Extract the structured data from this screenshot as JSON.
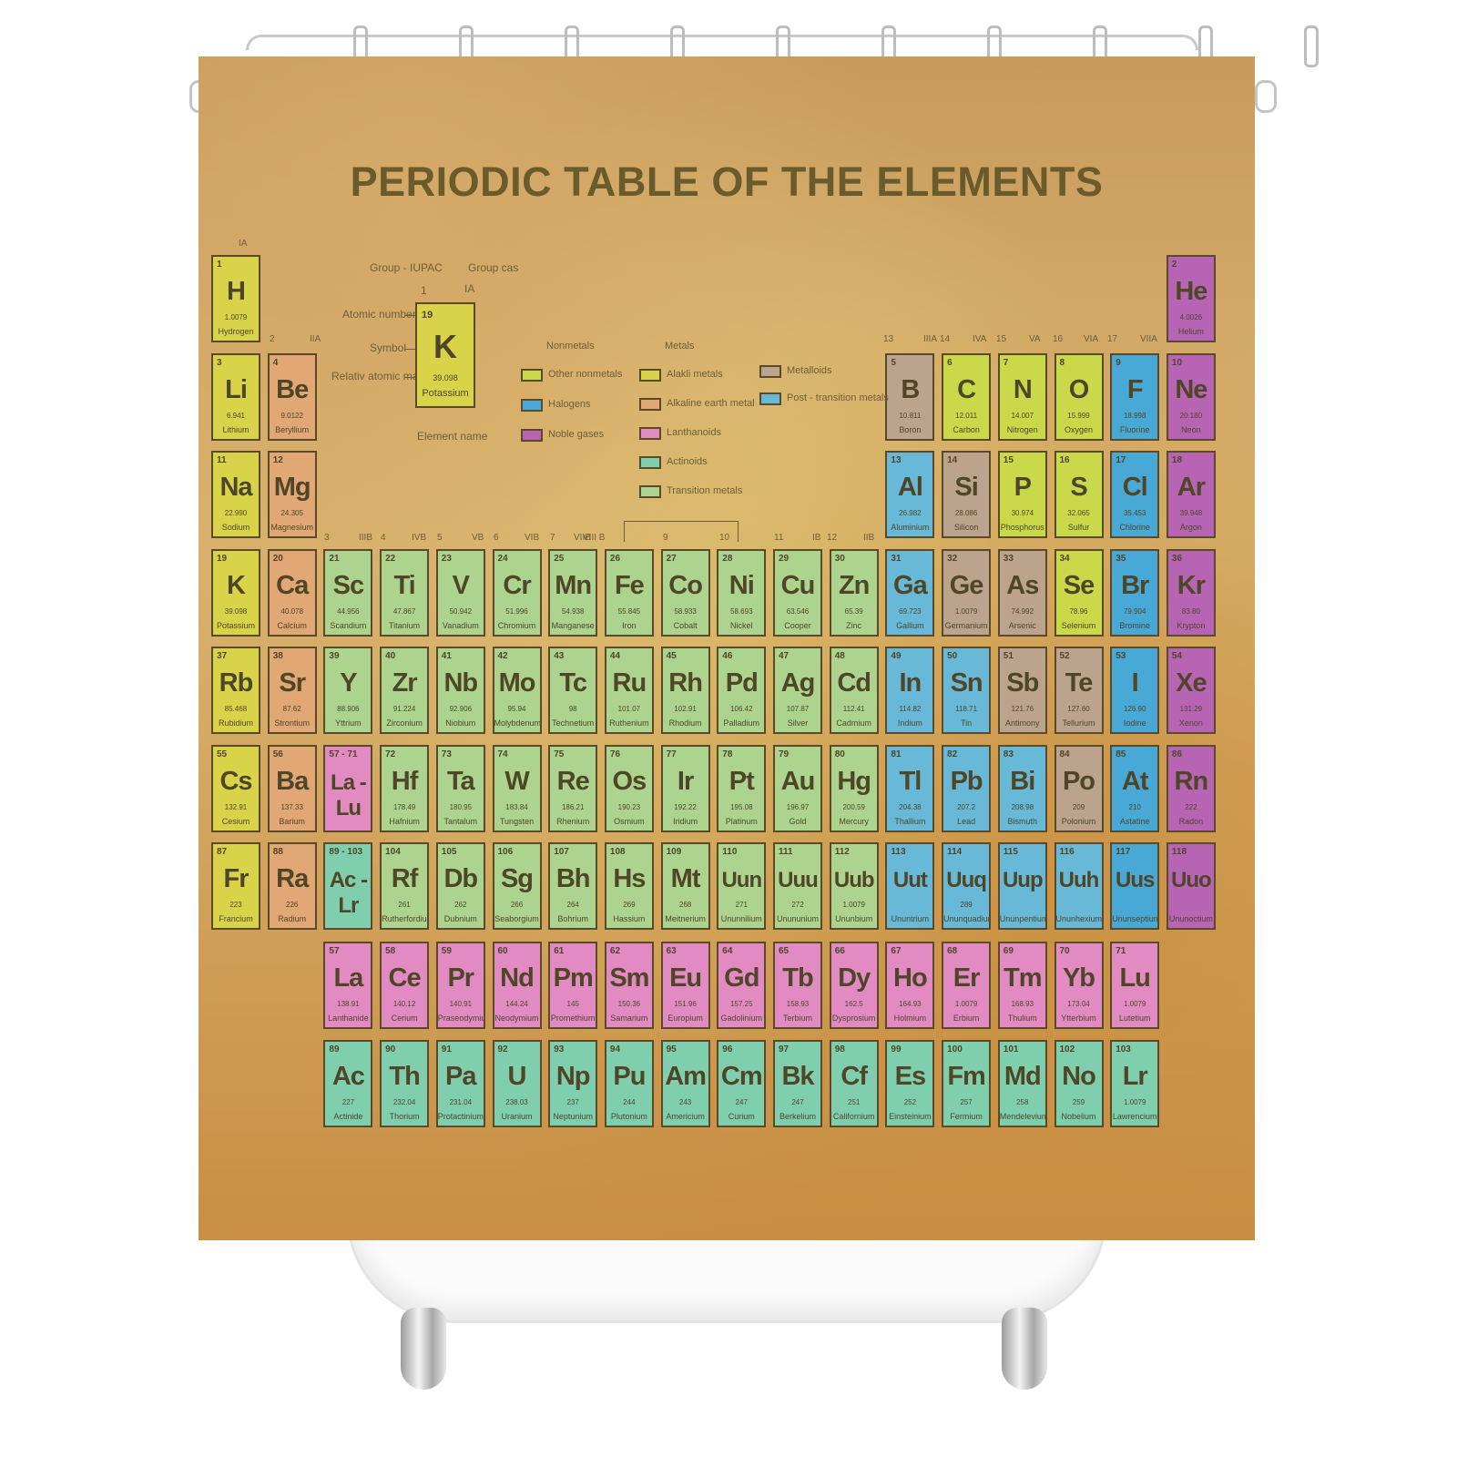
{
  "title": "PERIODIC  TABLE OF THE ELEMENTS",
  "key": {
    "group_iupac": "Group - IUPAC",
    "group_cas": "Group cas",
    "group_iupac_value": "1",
    "group_cas_value": "IA",
    "atomic_number": "Atomic number",
    "symbol": "Symbol",
    "relative_atomic_mass": "Relativ atomic mass",
    "element_name": "Element name",
    "cell": {
      "num": "19",
      "sym": "K",
      "mass": "39.098",
      "name": "Potassium"
    }
  },
  "legend": {
    "nonmetals_heading": "Nonmetals",
    "metals_heading": "Metals",
    "nonmetals": [
      {
        "label": "Other nonmetals",
        "color": "#c9d94a"
      },
      {
        "label": "Halogens",
        "color": "#48a8d6"
      },
      {
        "label": "Noble gases",
        "color": "#b764b4"
      }
    ],
    "metals": [
      {
        "label": "Alakli metals",
        "color": "#d9d34a"
      },
      {
        "label": "Alkaline earth metal",
        "color": "#e1a774"
      },
      {
        "label": "Lanthanoids",
        "color": "#e18bc2"
      },
      {
        "label": "Actinoids",
        "color": "#7fcfae"
      },
      {
        "label": "Transition metals",
        "color": "#acd48e"
      }
    ],
    "others": [
      {
        "label": "Metalloids",
        "color": "#bba38e"
      },
      {
        "label": "Post - transition metals",
        "color": "#68b8d8"
      }
    ]
  },
  "group_labels": [
    {
      "text": "IA"
    },
    {
      "text": "2"
    },
    {
      "text": "IIA"
    },
    {
      "text": "3"
    },
    {
      "text": "IIIB"
    },
    {
      "text": "4"
    },
    {
      "text": "IVB"
    },
    {
      "text": "5"
    },
    {
      "text": "VB"
    },
    {
      "text": "6"
    },
    {
      "text": "VIB"
    },
    {
      "text": "7"
    },
    {
      "text": "VIIB"
    },
    {
      "text": "VIII B"
    },
    {
      "text": "9"
    },
    {
      "text": "10"
    },
    {
      "text": "11"
    },
    {
      "text": "IB"
    },
    {
      "text": "12"
    },
    {
      "text": "IIB"
    },
    {
      "text": "13"
    },
    {
      "text": "IIIA"
    },
    {
      "text": "14"
    },
    {
      "text": "IVA"
    },
    {
      "text": "15"
    },
    {
      "text": "VA"
    },
    {
      "text": "16"
    },
    {
      "text": "VIA"
    },
    {
      "text": "17"
    },
    {
      "text": "VIIA"
    }
  ],
  "elements": [
    {
      "num": "1",
      "sym": "H",
      "mass": "1.0079",
      "name": "Hydrogen",
      "cls": "alkali"
    },
    {
      "num": "2",
      "sym": "He",
      "mass": "4.0026",
      "name": "Helium",
      "cls": "noble"
    },
    {
      "num": "3",
      "sym": "Li",
      "mass": "6.941",
      "name": "Lithium",
      "cls": "alkali"
    },
    {
      "num": "4",
      "sym": "Be",
      "mass": "9.0122",
      "name": "Beryllium",
      "cls": "alkaline"
    },
    {
      "num": "5",
      "sym": "B",
      "mass": "10.811",
      "name": "Boron",
      "cls": "metalloid"
    },
    {
      "num": "6",
      "sym": "C",
      "mass": "12.011",
      "name": "Carbon",
      "cls": "other"
    },
    {
      "num": "7",
      "sym": "N",
      "mass": "14.007",
      "name": "Nitrogen",
      "cls": "other"
    },
    {
      "num": "8",
      "sym": "O",
      "mass": "15.999",
      "name": "Oxygen",
      "cls": "other"
    },
    {
      "num": "9",
      "sym": "F",
      "mass": "18.998",
      "name": "Fluorine",
      "cls": "halogen"
    },
    {
      "num": "10",
      "sym": "Ne",
      "mass": "20.180",
      "name": "Neon",
      "cls": "noble"
    },
    {
      "num": "11",
      "sym": "Na",
      "mass": "22.990",
      "name": "Sodium",
      "cls": "alkali"
    },
    {
      "num": "12",
      "sym": "Mg",
      "mass": "24.305",
      "name": "Magnesium",
      "cls": "alkaline"
    },
    {
      "num": "13",
      "sym": "Al",
      "mass": "26.982",
      "name": "Aluminium",
      "cls": "post"
    },
    {
      "num": "14",
      "sym": "Si",
      "mass": "28.086",
      "name": "Silicon",
      "cls": "metalloid"
    },
    {
      "num": "15",
      "sym": "P",
      "mass": "30.974",
      "name": "Phosphorus",
      "cls": "other"
    },
    {
      "num": "16",
      "sym": "S",
      "mass": "32.065",
      "name": "Sulfur",
      "cls": "other"
    },
    {
      "num": "17",
      "sym": "Cl",
      "mass": "35.453",
      "name": "Chlorine",
      "cls": "halogen"
    },
    {
      "num": "18",
      "sym": "Ar",
      "mass": "39.948",
      "name": "Argon",
      "cls": "noble"
    },
    {
      "num": "19",
      "sym": "K",
      "mass": "39.098",
      "name": "Potassium",
      "cls": "alkali"
    },
    {
      "num": "20",
      "sym": "Ca",
      "mass": "40.078",
      "name": "Calcium",
      "cls": "alkaline"
    },
    {
      "num": "21",
      "sym": "Sc",
      "mass": "44.956",
      "name": "Scandium",
      "cls": "transition"
    },
    {
      "num": "22",
      "sym": "Ti",
      "mass": "47.867",
      "name": "Titanium",
      "cls": "transition"
    },
    {
      "num": "23",
      "sym": "V",
      "mass": "50.942",
      "name": "Vanadium",
      "cls": "transition"
    },
    {
      "num": "24",
      "sym": "Cr",
      "mass": "51.996",
      "name": "Chromium",
      "cls": "transition"
    },
    {
      "num": "25",
      "sym": "Mn",
      "mass": "54.938",
      "name": "Manganese",
      "cls": "transition"
    },
    {
      "num": "26",
      "sym": "Fe",
      "mass": "55.845",
      "name": "Iron",
      "cls": "transition"
    },
    {
      "num": "27",
      "sym": "Co",
      "mass": "58.933",
      "name": "Cobalt",
      "cls": "transition"
    },
    {
      "num": "28",
      "sym": "Ni",
      "mass": "58.693",
      "name": "Nickel",
      "cls": "transition"
    },
    {
      "num": "29",
      "sym": "Cu",
      "mass": "63.546",
      "name": "Cooper",
      "cls": "transition"
    },
    {
      "num": "30",
      "sym": "Zn",
      "mass": "65.39",
      "name": "Zinc",
      "cls": "transition"
    },
    {
      "num": "31",
      "sym": "Ga",
      "mass": "69.723",
      "name": "Gallium",
      "cls": "post"
    },
    {
      "num": "32",
      "sym": "Ge",
      "mass": "1.0079",
      "name": "Germanium",
      "cls": "metalloid"
    },
    {
      "num": "33",
      "sym": "As",
      "mass": "74.992",
      "name": "Arsenic",
      "cls": "metalloid"
    },
    {
      "num": "34",
      "sym": "Se",
      "mass": "78.96",
      "name": "Selenium",
      "cls": "other"
    },
    {
      "num": "35",
      "sym": "Br",
      "mass": "79.904",
      "name": "Bromine",
      "cls": "halogen"
    },
    {
      "num": "36",
      "sym": "Kr",
      "mass": "83.80",
      "name": "Krypton",
      "cls": "noble"
    },
    {
      "num": "37",
      "sym": "Rb",
      "mass": "85.468",
      "name": "Rubidium",
      "cls": "alkali"
    },
    {
      "num": "38",
      "sym": "Sr",
      "mass": "87.62",
      "name": "Strontium",
      "cls": "alkaline"
    },
    {
      "num": "39",
      "sym": "Y",
      "mass": "88.906",
      "name": "Yttrium",
      "cls": "transition"
    },
    {
      "num": "40",
      "sym": "Zr",
      "mass": "91.224",
      "name": "Zirconium",
      "cls": "transition"
    },
    {
      "num": "41",
      "sym": "Nb",
      "mass": "92.906",
      "name": "Niobium",
      "cls": "transition"
    },
    {
      "num": "42",
      "sym": "Mo",
      "mass": "95.94",
      "name": "Molybdenum",
      "cls": "transition"
    },
    {
      "num": "43",
      "sym": "Tc",
      "mass": "98",
      "name": "Technetium",
      "cls": "transition"
    },
    {
      "num": "44",
      "sym": "Ru",
      "mass": "101.07",
      "name": "Ruthenium",
      "cls": "transition"
    },
    {
      "num": "45",
      "sym": "Rh",
      "mass": "102.91",
      "name": "Rhodium",
      "cls": "transition"
    },
    {
      "num": "46",
      "sym": "Pd",
      "mass": "106.42",
      "name": "Palladium",
      "cls": "transition"
    },
    {
      "num": "47",
      "sym": "Ag",
      "mass": "107.87",
      "name": "Silver",
      "cls": "transition"
    },
    {
      "num": "48",
      "sym": "Cd",
      "mass": "112.41",
      "name": "Cadmium",
      "cls": "transition"
    },
    {
      "num": "49",
      "sym": "In",
      "mass": "114.82",
      "name": "Indium",
      "cls": "post"
    },
    {
      "num": "50",
      "sym": "Sn",
      "mass": "118.71",
      "name": "Tin",
      "cls": "post"
    },
    {
      "num": "51",
      "sym": "Sb",
      "mass": "121.76",
      "name": "Antimony",
      "cls": "metalloid"
    },
    {
      "num": "52",
      "sym": "Te",
      "mass": "127.60",
      "name": "Tellurium",
      "cls": "metalloid"
    },
    {
      "num": "53",
      "sym": "I",
      "mass": "126.90",
      "name": "Iodine",
      "cls": "halogen"
    },
    {
      "num": "54",
      "sym": "Xe",
      "mass": "131.29",
      "name": "Xenon",
      "cls": "noble"
    },
    {
      "num": "55",
      "sym": "Cs",
      "mass": "132.91",
      "name": "Cesium",
      "cls": "alkali"
    },
    {
      "num": "56",
      "sym": "Ba",
      "mass": "137.33",
      "name": "Barium",
      "cls": "alkaline"
    },
    {
      "num": "57 - 71",
      "sym": "La - Lu",
      "mass": "",
      "name": "",
      "cls": "lanth"
    },
    {
      "num": "72",
      "sym": "Hf",
      "mass": "178.49",
      "name": "Hafnium",
      "cls": "transition"
    },
    {
      "num": "73",
      "sym": "Ta",
      "mass": "180.95",
      "name": "Tantalum",
      "cls": "transition"
    },
    {
      "num": "74",
      "sym": "W",
      "mass": "183.84",
      "name": "Tungsten",
      "cls": "transition"
    },
    {
      "num": "75",
      "sym": "Re",
      "mass": "186.21",
      "name": "Rhenium",
      "cls": "transition"
    },
    {
      "num": "76",
      "sym": "Os",
      "mass": "190.23",
      "name": "Osmium",
      "cls": "transition"
    },
    {
      "num": "77",
      "sym": "Ir",
      "mass": "192.22",
      "name": "Iridium",
      "cls": "transition"
    },
    {
      "num": "78",
      "sym": "Pt",
      "mass": "195.08",
      "name": "Platinum",
      "cls": "transition"
    },
    {
      "num": "79",
      "sym": "Au",
      "mass": "196.97",
      "name": "Gold",
      "cls": "transition"
    },
    {
      "num": "80",
      "sym": "Hg",
      "mass": "200.59",
      "name": "Mercury",
      "cls": "transition"
    },
    {
      "num": "81",
      "sym": "Tl",
      "mass": "204.38",
      "name": "Thallium",
      "cls": "post"
    },
    {
      "num": "82",
      "sym": "Pb",
      "mass": "207.2",
      "name": "Lead",
      "cls": "post"
    },
    {
      "num": "83",
      "sym": "Bi",
      "mass": "208.98",
      "name": "Bismuth",
      "cls": "post"
    },
    {
      "num": "84",
      "sym": "Po",
      "mass": "209",
      "name": "Polonium",
      "cls": "metalloid"
    },
    {
      "num": "85",
      "sym": "At",
      "mass": "210",
      "name": "Astatine",
      "cls": "halogen"
    },
    {
      "num": "86",
      "sym": "Rn",
      "mass": "222",
      "name": "Radon",
      "cls": "noble"
    },
    {
      "num": "87",
      "sym": "Fr",
      "mass": "223",
      "name": "Francium",
      "cls": "alkali"
    },
    {
      "num": "88",
      "sym": "Ra",
      "mass": "226",
      "name": "Radium",
      "cls": "alkaline"
    },
    {
      "num": "89 - 103",
      "sym": "Ac - Lr",
      "mass": "",
      "name": "",
      "cls": "actin"
    },
    {
      "num": "104",
      "sym": "Rf",
      "mass": "261",
      "name": "Rutherfordium",
      "cls": "transition"
    },
    {
      "num": "105",
      "sym": "Db",
      "mass": "262",
      "name": "Dubnium",
      "cls": "transition"
    },
    {
      "num": "106",
      "sym": "Sg",
      "mass": "266",
      "name": "Seaborgium",
      "cls": "transition"
    },
    {
      "num": "107",
      "sym": "Bh",
      "mass": "264",
      "name": "Bohrium",
      "cls": "transition"
    },
    {
      "num": "108",
      "sym": "Hs",
      "mass": "269",
      "name": "Hassium",
      "cls": "transition"
    },
    {
      "num": "109",
      "sym": "Mt",
      "mass": "268",
      "name": "Meitnerium",
      "cls": "transition"
    },
    {
      "num": "110",
      "sym": "Uun",
      "mass": "271",
      "name": "Ununnilium",
      "cls": "transition"
    },
    {
      "num": "111",
      "sym": "Uuu",
      "mass": "272",
      "name": "Unununium",
      "cls": "transition"
    },
    {
      "num": "112",
      "sym": "Uub",
      "mass": "1.0079",
      "name": "Ununbium",
      "cls": "transition"
    },
    {
      "num": "113",
      "sym": "Uut",
      "mass": "",
      "name": "Ununtrium",
      "cls": "post"
    },
    {
      "num": "114",
      "sym": "Uuq",
      "mass": "289",
      "name": "Ununquadium",
      "cls": "post"
    },
    {
      "num": "115",
      "sym": "Uup",
      "mass": "",
      "name": "Ununpentium",
      "cls": "post"
    },
    {
      "num": "116",
      "sym": "Uuh",
      "mass": "",
      "name": "Ununhexium",
      "cls": "post"
    },
    {
      "num": "117",
      "sym": "Uus",
      "mass": "",
      "name": "Ununseptium",
      "cls": "halogen"
    },
    {
      "num": "118",
      "sym": "Uuo",
      "mass": "",
      "name": "Ununoctium",
      "cls": "noble"
    },
    {
      "num": "57",
      "sym": "La",
      "mass": "138.91",
      "name": "Lanthanide",
      "cls": "lanth"
    },
    {
      "num": "58",
      "sym": "Ce",
      "mass": "140.12",
      "name": "Cerium",
      "cls": "lanth"
    },
    {
      "num": "59",
      "sym": "Pr",
      "mass": "140.91",
      "name": "Praseodymium",
      "cls": "lanth"
    },
    {
      "num": "60",
      "sym": "Nd",
      "mass": "144.24",
      "name": "Neodymium",
      "cls": "lanth"
    },
    {
      "num": "61",
      "sym": "Pm",
      "mass": "145",
      "name": "Promethium",
      "cls": "lanth"
    },
    {
      "num": "62",
      "sym": "Sm",
      "mass": "150.36",
      "name": "Samarium",
      "cls": "lanth"
    },
    {
      "num": "63",
      "sym": "Eu",
      "mass": "151.96",
      "name": "Europium",
      "cls": "lanth"
    },
    {
      "num": "64",
      "sym": "Gd",
      "mass": "157.25",
      "name": "Gadolinium",
      "cls": "lanth"
    },
    {
      "num": "65",
      "sym": "Tb",
      "mass": "158.93",
      "name": "Terbium",
      "cls": "lanth"
    },
    {
      "num": "66",
      "sym": "Dy",
      "mass": "162.5",
      "name": "Dysprosium",
      "cls": "lanth"
    },
    {
      "num": "67",
      "sym": "Ho",
      "mass": "164.93",
      "name": "Holmium",
      "cls": "lanth"
    },
    {
      "num": "68",
      "sym": "Er",
      "mass": "1.0079",
      "name": "Erbium",
      "cls": "lanth"
    },
    {
      "num": "69",
      "sym": "Tm",
      "mass": "168.93",
      "name": "Thulium",
      "cls": "lanth"
    },
    {
      "num": "70",
      "sym": "Yb",
      "mass": "173.04",
      "name": "Ytterbium",
      "cls": "lanth"
    },
    {
      "num": "71",
      "sym": "Lu",
      "mass": "1.0079",
      "name": "Lutetium",
      "cls": "lanth"
    },
    {
      "num": "89",
      "sym": "Ac",
      "mass": "227",
      "name": "Actinide",
      "cls": "actin"
    },
    {
      "num": "90",
      "sym": "Th",
      "mass": "232.04",
      "name": "Thorium",
      "cls": "actin"
    },
    {
      "num": "91",
      "sym": "Pa",
      "mass": "231.04",
      "name": "Protactinium",
      "cls": "actin"
    },
    {
      "num": "92",
      "sym": "U",
      "mass": "238.03",
      "name": "Uranium",
      "cls": "actin"
    },
    {
      "num": "93",
      "sym": "Np",
      "mass": "237",
      "name": "Neptunium",
      "cls": "actin"
    },
    {
      "num": "94",
      "sym": "Pu",
      "mass": "244",
      "name": "Plutonium",
      "cls": "actin"
    },
    {
      "num": "95",
      "sym": "Am",
      "mass": "243",
      "name": "Americium",
      "cls": "actin"
    },
    {
      "num": "96",
      "sym": "Cm",
      "mass": "247",
      "name": "Curium",
      "cls": "actin"
    },
    {
      "num": "97",
      "sym": "Bk",
      "mass": "247",
      "name": "Berkelium",
      "cls": "actin"
    },
    {
      "num": "98",
      "sym": "Cf",
      "mass": "251",
      "name": "Californium",
      "cls": "actin"
    },
    {
      "num": "99",
      "sym": "Es",
      "mass": "252",
      "name": "Einsteinium",
      "cls": "actin"
    },
    {
      "num": "100",
      "sym": "Fm",
      "mass": "257",
      "name": "Fermium",
      "cls": "actin"
    },
    {
      "num": "101",
      "sym": "Md",
      "mass": "258",
      "name": "Mendelevium",
      "cls": "actin"
    },
    {
      "num": "102",
      "sym": "No",
      "mass": "259",
      "name": "Nobelium",
      "cls": "actin"
    },
    {
      "num": "103",
      "sym": "Lr",
      "mass": "1.0079",
      "name": "Lawrencium",
      "cls": "actin"
    }
  ]
}
